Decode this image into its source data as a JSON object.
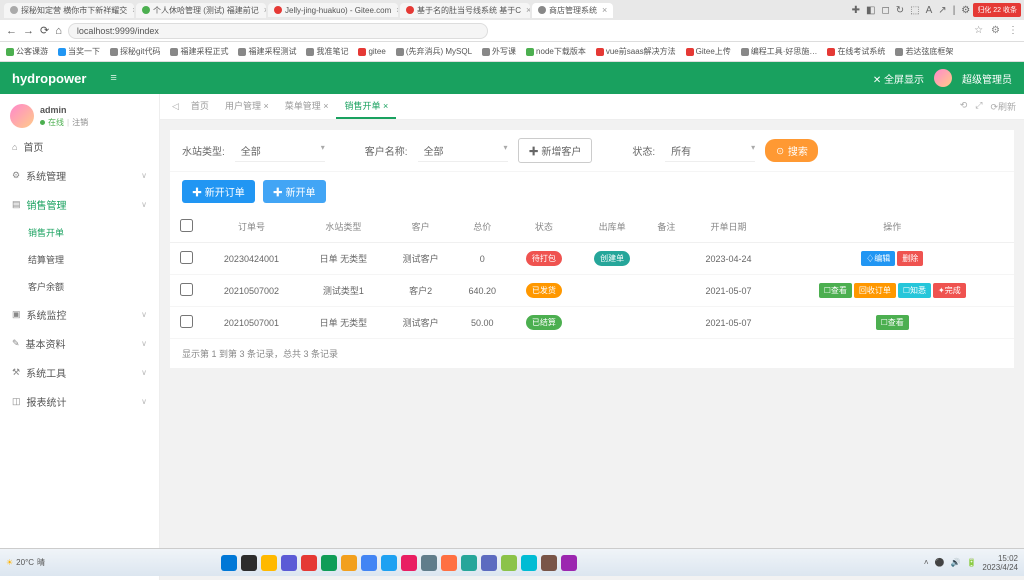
{
  "browser": {
    "tabs": [
      {
        "title": "探秘知定营 横你市下新祥耀交",
        "color": "#aaa"
      },
      {
        "title": "个人休哈管理 (测试) 福建前记",
        "color": "#4caf50"
      },
      {
        "title": "Jelly-jing-huakuo) - Gitee.com",
        "color": "#e53935"
      },
      {
        "title": "基于名的肚当号线系统 基于C",
        "color": "#e53935"
      },
      {
        "title": "商店管理系统",
        "color": "#888",
        "active": true
      }
    ],
    "window_btns": [
      "✚",
      "◧",
      "◻",
      "↻",
      "⬚",
      "A",
      "↗",
      "|",
      "⚙",
      "⤢",
      "◑",
      "−",
      "×"
    ],
    "address": "localhost:9999/index",
    "nav_icons": [
      "←",
      "→",
      "⟳",
      "⌂"
    ],
    "addr_right": [
      "☆",
      "⚙",
      "⋮"
    ],
    "bookmarks": [
      {
        "label": "公客课游",
        "color": "#4caf50"
      },
      {
        "label": "当奖一下",
        "color": "#2196f3"
      },
      {
        "label": "探秘git代码",
        "color": "#888"
      },
      {
        "label": "福建采程正式",
        "color": "#888"
      },
      {
        "label": "福建采程测试",
        "color": "#888"
      },
      {
        "label": "我准笔记",
        "color": "#888"
      },
      {
        "label": "gitee",
        "color": "#e53935"
      },
      {
        "label": "(先弃消兵) MySQL",
        "color": "#888"
      },
      {
        "label": "外写课",
        "color": "#888"
      },
      {
        "label": "node下载版本",
        "color": "#4caf50"
      },
      {
        "label": "vue前saas解决方法",
        "color": "#e53935"
      },
      {
        "label": "Gitee上传",
        "color": "#e53935"
      },
      {
        "label": "编程工具·好思施…",
        "color": "#888"
      },
      {
        "label": "在线考试系统",
        "color": "#e53935"
      },
      {
        "label": "若达弦底框架",
        "color": "#888"
      }
    ],
    "red_badge": "归化 22 收条"
  },
  "app": {
    "title": "hydropower",
    "fullscreen": "✕ 全屏显示",
    "user_top": "超级管理员"
  },
  "sidebar": {
    "user": {
      "name": "admin",
      "status": "在线",
      "action": "注销"
    },
    "items": [
      {
        "label": "首页",
        "icon": "⌂",
        "children": []
      },
      {
        "label": "系统管理",
        "icon": "⚙",
        "expand": true,
        "children": []
      },
      {
        "label": "销售管理",
        "icon": "▤",
        "expand": true,
        "active": true,
        "children": [
          {
            "label": "销售开单",
            "active": true
          },
          {
            "label": "结算管理"
          },
          {
            "label": "客户余额"
          }
        ]
      },
      {
        "label": "系统监控",
        "icon": "▣",
        "expand": true,
        "children": []
      },
      {
        "label": "基本资料",
        "icon": "✎",
        "expand": true,
        "children": []
      },
      {
        "label": "系统工具",
        "icon": "⚒",
        "expand": true,
        "children": []
      },
      {
        "label": "报表统计",
        "icon": "◫",
        "expand": true,
        "children": []
      }
    ]
  },
  "tabs": {
    "left_icon": "◁",
    "items": [
      {
        "label": "首页"
      },
      {
        "label": "用户管理 ×"
      },
      {
        "label": "菜单管理 ×"
      },
      {
        "label": "销售开单 ×",
        "active": true
      }
    ],
    "right_icons": [
      "⟲",
      "⤢",
      "⟳刷新"
    ]
  },
  "filters": {
    "f1": {
      "label": "水站类型:",
      "value": "全部"
    },
    "f2": {
      "label": "客户名称:",
      "value": "全部"
    },
    "add_customer": "✚ 新增客户",
    "f3": {
      "label": "状态:",
      "value": "所有"
    },
    "search": "☉ 搜索"
  },
  "actions": {
    "btn1": "✚ 新开订单",
    "btn2": "✚ 新开单"
  },
  "table": {
    "cols": [
      "",
      "订单号",
      "水站类型",
      "客户",
      "总价",
      "状态",
      "出库单",
      "备注",
      "开单日期",
      "操作"
    ],
    "rows": [
      {
        "id": "20230424001",
        "site": "日单 无类型",
        "cust": "测试客户",
        "price": "0",
        "status": {
          "text": "待打包",
          "cls": "bg-red"
        },
        "out": {
          "text": "创建单",
          "cls": "bg-teal"
        },
        "note": "",
        "date": "2023-04-24",
        "ops": [
          {
            "t": "♢编辑",
            "c": "ob-blue"
          },
          {
            "t": "删除",
            "c": "ob-red"
          }
        ]
      },
      {
        "id": "20210507002",
        "site": "测试类型1",
        "cust": "客户2",
        "price": "640.20",
        "status": {
          "text": "已发货",
          "cls": "bg-orange"
        },
        "out": null,
        "note": "",
        "date": "2021-05-07",
        "ops": [
          {
            "t": "☐查看",
            "c": "ob-green"
          },
          {
            "t": "回收订单",
            "c": "ob-orange"
          },
          {
            "t": "☐知悉",
            "c": "ob-cyan"
          },
          {
            "t": "✦完成",
            "c": "ob-red"
          }
        ]
      },
      {
        "id": "20210507001",
        "site": "日单 无类型",
        "cust": "测试客户",
        "price": "50.00",
        "status": {
          "text": "已结算",
          "cls": "bg-green"
        },
        "out": null,
        "note": "",
        "date": "2021-05-07",
        "ops": [
          {
            "t": "☐查看",
            "c": "ob-green"
          }
        ]
      }
    ],
    "footer": "显示第 1 到第 3 条记录，总共 3 条记录"
  },
  "taskbar": {
    "weather": "20°C",
    "weather_desc": "晴",
    "icons": [
      "#0078d7",
      "#2d2d2d",
      "#ffb900",
      "#5b5bd6",
      "#e53935",
      "#0f9d58",
      "#f2a01e",
      "#4285f4",
      "#1da1f2",
      "#e91e63",
      "#607d8b",
      "#ff7043",
      "#26a69a",
      "#5c6bc0",
      "#8bc34a",
      "#00bcd4",
      "#795548",
      "#9c27b0"
    ],
    "time": "15:02",
    "date": "2023/4/24"
  }
}
